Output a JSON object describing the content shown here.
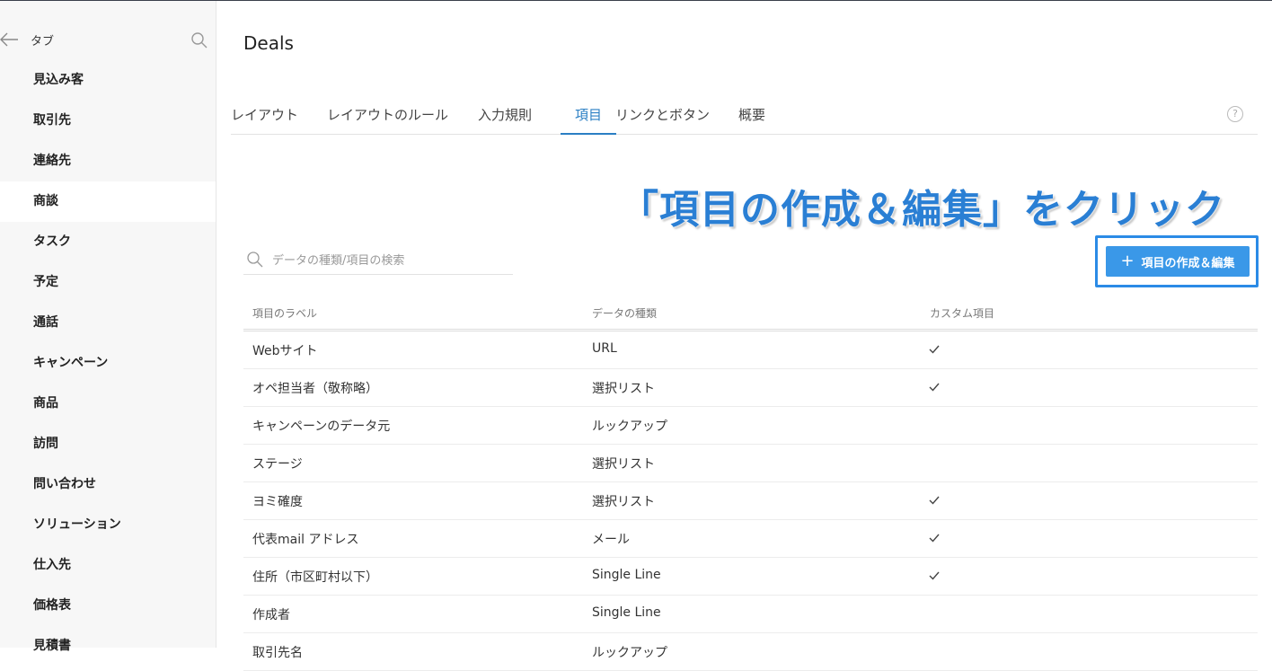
{
  "sidebar": {
    "title": "タブ",
    "items": [
      {
        "label": "見込み客",
        "active": false
      },
      {
        "label": "取引先",
        "active": false
      },
      {
        "label": "連絡先",
        "active": false
      },
      {
        "label": "商談",
        "active": true
      },
      {
        "label": "タスク",
        "active": false
      },
      {
        "label": "予定",
        "active": false
      },
      {
        "label": "通話",
        "active": false
      },
      {
        "label": "キャンペーン",
        "active": false
      },
      {
        "label": "商品",
        "active": false
      },
      {
        "label": "訪問",
        "active": false
      },
      {
        "label": "問い合わせ",
        "active": false
      },
      {
        "label": "ソリューション",
        "active": false
      },
      {
        "label": "仕入先",
        "active": false
      },
      {
        "label": "価格表",
        "active": false
      },
      {
        "label": "見積書",
        "active": false
      }
    ]
  },
  "page": {
    "title": "Deals"
  },
  "tabs": [
    {
      "label": "レイアウト",
      "active": false
    },
    {
      "label": "レイアウトのルール",
      "active": false
    },
    {
      "label": "入力規則",
      "active": false
    },
    {
      "label": "項目",
      "active": true
    },
    {
      "label": "リンクとボタン",
      "active": false
    },
    {
      "label": "概要",
      "active": false
    }
  ],
  "help": {
    "label": "?"
  },
  "annotation": {
    "text": "「項目の作成＆編集」をクリック",
    "color": "#2a7fd4"
  },
  "search": {
    "placeholder": "データの種類/項目の検索"
  },
  "create_button": {
    "label": "項目の作成＆編集",
    "icon": "+",
    "color": "#3a98e8"
  },
  "table": {
    "headers": [
      "項目のラベル",
      "データの種類",
      "カスタム項目"
    ],
    "rows": [
      {
        "label": "Webサイト",
        "type": "URL",
        "custom": true
      },
      {
        "label": "オペ担当者（敬称略）",
        "type": "選択リスト",
        "custom": true
      },
      {
        "label": "キャンペーンのデータ元",
        "type": "ルックアップ",
        "custom": false
      },
      {
        "label": "ステージ",
        "type": "選択リスト",
        "custom": false
      },
      {
        "label": "ヨミ確度",
        "type": "選択リスト",
        "custom": true
      },
      {
        "label": "代表mail アドレス",
        "type": "メール",
        "custom": true
      },
      {
        "label": "住所（市区町村以下）",
        "type": "Single Line",
        "custom": true
      },
      {
        "label": "作成者",
        "type": "Single Line",
        "custom": false
      },
      {
        "label": "取引先名",
        "type": "ルックアップ",
        "custom": false
      }
    ]
  },
  "colors": {
    "accent": "#2b7fc4",
    "sidebar_bg": "#f7f7f7"
  }
}
